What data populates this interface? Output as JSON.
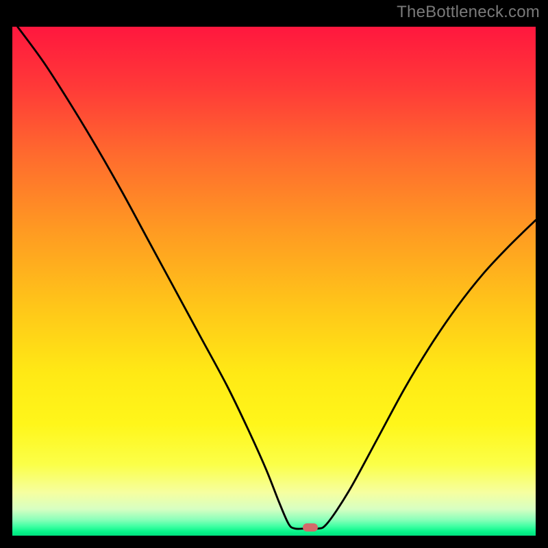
{
  "watermark": "TheBottleneck.com",
  "colors": {
    "gradient_stops": [
      {
        "offset": 0.0,
        "color": "#ff173e"
      },
      {
        "offset": 0.12,
        "color": "#ff3a38"
      },
      {
        "offset": 0.25,
        "color": "#ff6a2e"
      },
      {
        "offset": 0.4,
        "color": "#ff9a22"
      },
      {
        "offset": 0.55,
        "color": "#ffc619"
      },
      {
        "offset": 0.68,
        "color": "#ffe915"
      },
      {
        "offset": 0.78,
        "color": "#fff61a"
      },
      {
        "offset": 0.86,
        "color": "#fbff48"
      },
      {
        "offset": 0.915,
        "color": "#f6ffa0"
      },
      {
        "offset": 0.948,
        "color": "#d7ffc2"
      },
      {
        "offset": 0.968,
        "color": "#8dffba"
      },
      {
        "offset": 0.982,
        "color": "#3dffa2"
      },
      {
        "offset": 0.992,
        "color": "#08f58a"
      },
      {
        "offset": 1.0,
        "color": "#02e07e"
      }
    ],
    "curve_stroke": "#000000",
    "marker_fill": "#d46a6a",
    "background": "#000000",
    "watermark_text": "#7a7a7a"
  },
  "chart_data": {
    "type": "line",
    "title": "",
    "xlabel": "",
    "ylabel": "",
    "xlim": [
      0,
      100
    ],
    "ylim": [
      0,
      100
    ],
    "grid": false,
    "legend": false,
    "series": [
      {
        "name": "bottleneck-curve",
        "points": [
          {
            "x": 1.0,
            "y": 100.0
          },
          {
            "x": 6.0,
            "y": 93.0
          },
          {
            "x": 11.0,
            "y": 85.0
          },
          {
            "x": 16.0,
            "y": 76.5
          },
          {
            "x": 21.0,
            "y": 67.5
          },
          {
            "x": 26.0,
            "y": 58.0
          },
          {
            "x": 31.0,
            "y": 48.5
          },
          {
            "x": 36.0,
            "y": 39.0
          },
          {
            "x": 41.0,
            "y": 29.5
          },
          {
            "x": 45.0,
            "y": 21.0
          },
          {
            "x": 48.5,
            "y": 13.0
          },
          {
            "x": 51.0,
            "y": 6.5
          },
          {
            "x": 52.8,
            "y": 2.3
          },
          {
            "x": 54.0,
            "y": 1.4
          },
          {
            "x": 56.0,
            "y": 1.4
          },
          {
            "x": 58.5,
            "y": 1.4
          },
          {
            "x": 59.8,
            "y": 2.0
          },
          {
            "x": 62.0,
            "y": 5.0
          },
          {
            "x": 65.0,
            "y": 10.0
          },
          {
            "x": 70.0,
            "y": 19.5
          },
          {
            "x": 75.0,
            "y": 29.0
          },
          {
            "x": 80.0,
            "y": 37.5
          },
          {
            "x": 85.0,
            "y": 45.0
          },
          {
            "x": 90.0,
            "y": 51.5
          },
          {
            "x": 95.0,
            "y": 57.0
          },
          {
            "x": 100.0,
            "y": 62.0
          }
        ]
      }
    ],
    "marker": {
      "x": 57.0,
      "y": 1.6
    }
  }
}
